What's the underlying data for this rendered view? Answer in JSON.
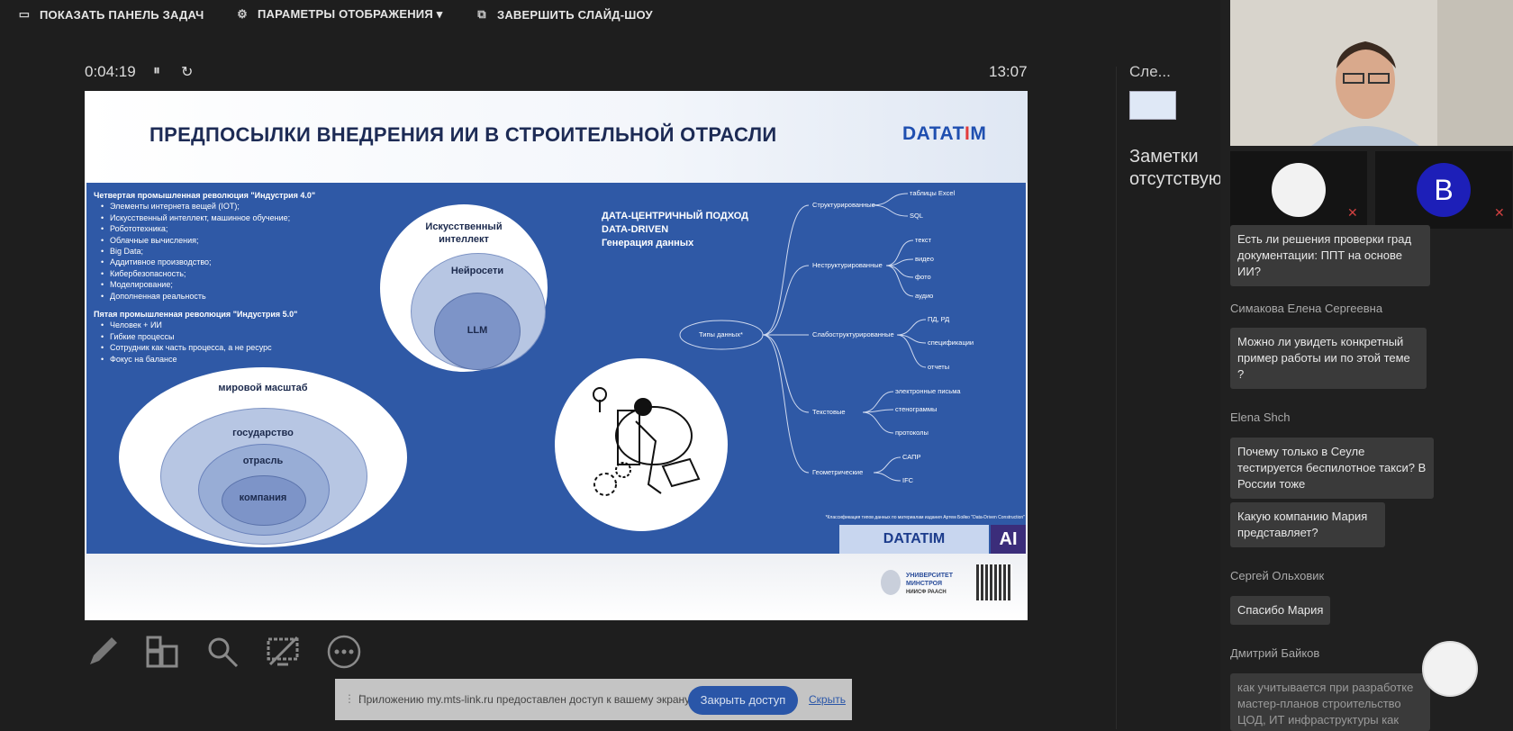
{
  "topbar": {
    "taskbar": "ПОКАЗАТЬ ПАНЕЛЬ ЗАДАЧ",
    "display": "ПАРАМЕТРЫ ОТОБРАЖЕНИЯ ▾",
    "end": "ЗАВЕРШИТЬ СЛАЙД-ШОУ"
  },
  "presenter": {
    "elapsed": "0:04:19",
    "clock": "13:07",
    "pause": "⏸",
    "restart": "↻"
  },
  "slide": {
    "title": "ПРЕДПОСЫЛКИ ВНЕДРЕНИЯ ИИ В СТРОИТЕЛЬНОЙ ОТРАСЛИ",
    "logo_a": "DATAT",
    "logo_b": "I",
    "logo_c": "M",
    "list1_head": "Четвертая промышленная революция \"Индустрия 4.0\"",
    "list1": [
      "Элементы интернета вещей (IOT);",
      "Искусственный интеллект, машинное обучение;",
      "Робототехника;",
      "Облачные вычисления;",
      "Big Data;",
      "Аддитивное производство;",
      "Кибербезопасность;",
      "Моделирование;",
      "Дополненная реальность"
    ],
    "list2_head": "Пятая промышленная революция \"Индустрия 5.0\"",
    "list2": [
      "Человек + ИИ",
      "Гибкие процессы",
      "Сотрудник как часть процесса, а не ресурс",
      "Фокус на балансе"
    ],
    "ai_outer": "Искусственный интеллект",
    "ai_mid": "Нейросети",
    "ai_inner": "LLM",
    "scale": [
      "мировой масштаб",
      "государство",
      "отрасль",
      "компания"
    ],
    "data_approach": [
      "ДАТА-ЦЕНТРИЧНЫЙ ПОДХОД",
      "DATA-DRIVEN",
      "Генерация данных"
    ],
    "tree_root": "Типы данных*",
    "tree_groups": [
      "Структурированные",
      "Неструктурированные",
      "Слабоструктурированные",
      "Текстовые",
      "Геометрические"
    ],
    "tree_leaves": [
      "таблицы Excel",
      "SQL",
      "текст",
      "видео",
      "фото",
      "аудио",
      "ПД, РД",
      "спецификации",
      "отчеты",
      "электронные письма",
      "стенограммы",
      "протоколы",
      "САПР",
      "IFC"
    ],
    "footnote": "*Классификация типов данных по материалам издания Артем Бойко \"Data-Driven Construction\"",
    "badge": "DATATIM",
    "badge_ai": "AI",
    "univ": "УНИВЕРСИТЕТ МИНСТРОЯ",
    "univ_sub": "НИИСФ РААСН"
  },
  "sidebar": {
    "next": "Сле...",
    "notes": "Заметки отсутствуют."
  },
  "participants": {
    "b_letter": "B"
  },
  "chat": [
    {
      "author": "",
      "text": "Есть ли решения проверки град документации: ППТ на основе ИИ?"
    },
    {
      "author": "Симакова Елена Сергеевна",
      "text": "Можно ли увидеть конкретный пример работы ии по этой теме ?"
    },
    {
      "author": "Elena Shch",
      "text": "Почему только в Сеуле тестируется беспилотное такси? В России тоже"
    },
    {
      "author": "",
      "text": "Какую компанию Мария представляет?"
    },
    {
      "author": "Сергей Ольховик",
      "text": "Спасибо Мария"
    },
    {
      "author": "Дмитрий Байков",
      "text": "как учитывается при разработке мастер-планов строительство ЦОД, ИТ инфраструктуры как"
    }
  ],
  "share": {
    "text": "Приложению my.mts-link.ru предоставлен доступ к вашему экрану.",
    "button": "Закрыть доступ",
    "hide": "Скрыть"
  }
}
